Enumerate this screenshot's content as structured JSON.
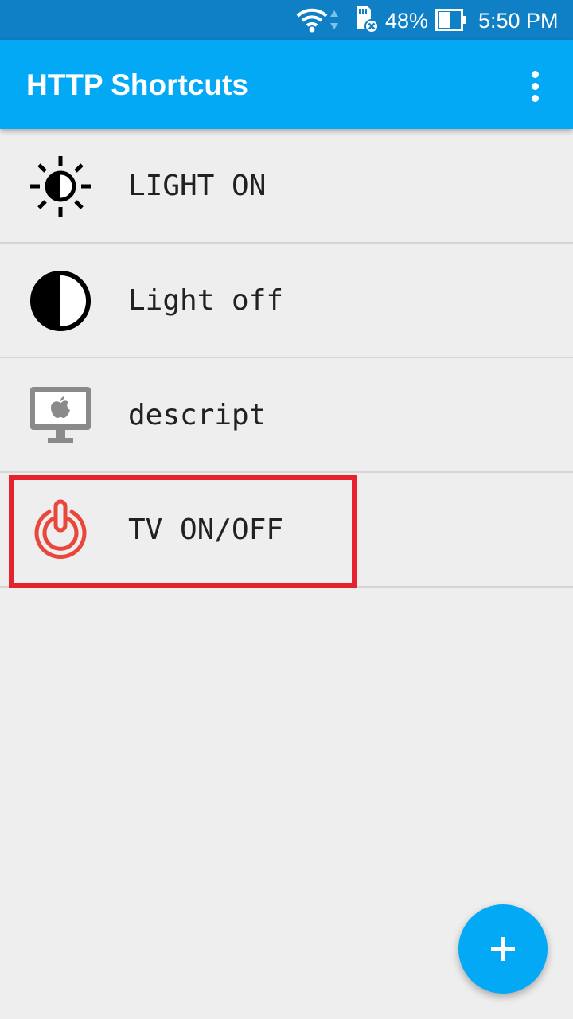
{
  "status_bar": {
    "battery_percent": "48%",
    "time": "5:50 PM",
    "icons": [
      "wifi-icon",
      "data-arrows-icon",
      "sd-card-icon",
      "battery-icon"
    ]
  },
  "app_bar": {
    "title": "HTTP Shortcuts",
    "menu_icon": "more-vert-icon"
  },
  "shortcuts": [
    {
      "label": "LIGHT ON",
      "icon": "brightness-icon"
    },
    {
      "label": "Light off",
      "icon": "half-circle-icon"
    },
    {
      "label": "descript",
      "icon": "imac-icon"
    },
    {
      "label": "TV ON/OFF",
      "icon": "power-icon",
      "highlighted": true
    }
  ],
  "fab": {
    "icon": "plus-icon"
  },
  "colors": {
    "status_bar": "#0f7fc6",
    "app_bar": "#03a9f4",
    "background": "#eeeeee",
    "highlight": "#e6222e",
    "power_icon": "#e8473b"
  }
}
